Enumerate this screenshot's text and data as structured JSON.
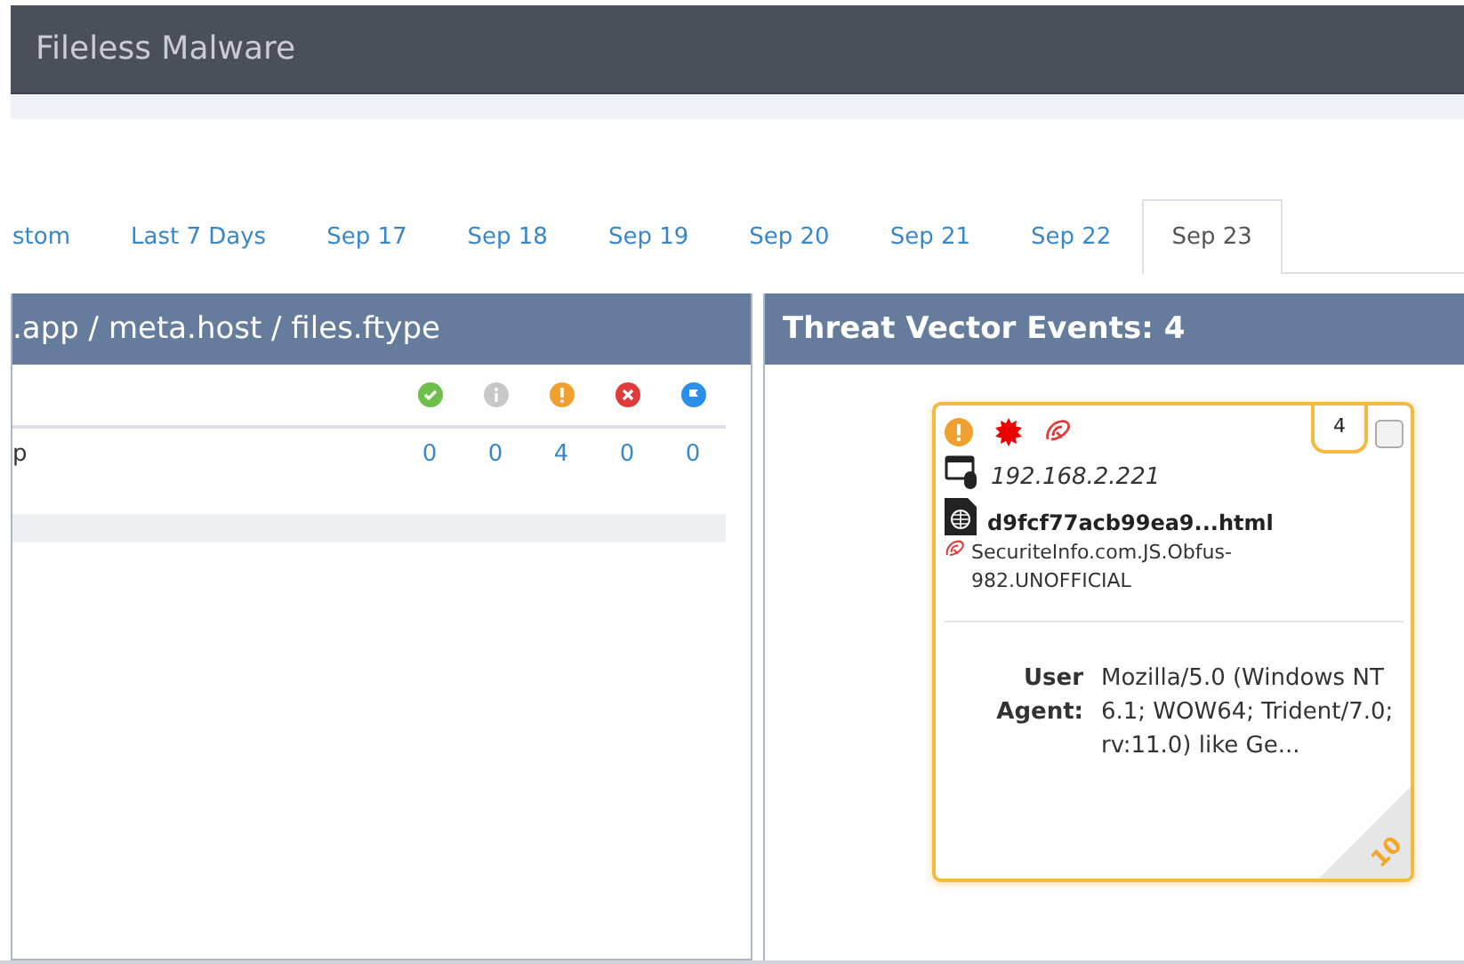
{
  "header": {
    "title": "Fileless Malware"
  },
  "tabs": [
    {
      "label": "stom",
      "selected": false
    },
    {
      "label": "Last 7 Days",
      "selected": false
    },
    {
      "label": "Sep 17",
      "selected": false
    },
    {
      "label": "Sep 18",
      "selected": false
    },
    {
      "label": "Sep 19",
      "selected": false
    },
    {
      "label": "Sep 20",
      "selected": false
    },
    {
      "label": "Sep 21",
      "selected": false
    },
    {
      "label": "Sep 22",
      "selected": false
    },
    {
      "label": "Sep 23",
      "selected": true
    }
  ],
  "left_panel": {
    "title": ".app / meta.host / files.ftype",
    "columns": [
      {
        "kind": "ok"
      },
      {
        "kind": "info"
      },
      {
        "kind": "warning"
      },
      {
        "kind": "error"
      },
      {
        "kind": "flag"
      }
    ],
    "rows": [
      {
        "label": "p",
        "counts": [
          "0",
          "0",
          "4",
          "0",
          "0"
        ]
      }
    ]
  },
  "right_panel": {
    "title": "Threat Vector Events: 4",
    "events": [
      {
        "badges": [
          {
            "kind": "warning"
          },
          {
            "kind": "virus"
          },
          {
            "kind": "signature"
          }
        ],
        "count": "4",
        "checked": false,
        "ip": "192.168.2.221",
        "filename": "d9fcf77acb99ea9...html",
        "detection": "SecuriteInfo.com.JS.Obfus-982.UNOFFICIAL",
        "fields": [
          {
            "label": "User Agent:",
            "value": "Mozilla/5.0 (Windows NT 6.1; WOW64; Trident/7.0; rv:11.0) like Ge..."
          }
        ],
        "score": "10"
      }
    ]
  }
}
